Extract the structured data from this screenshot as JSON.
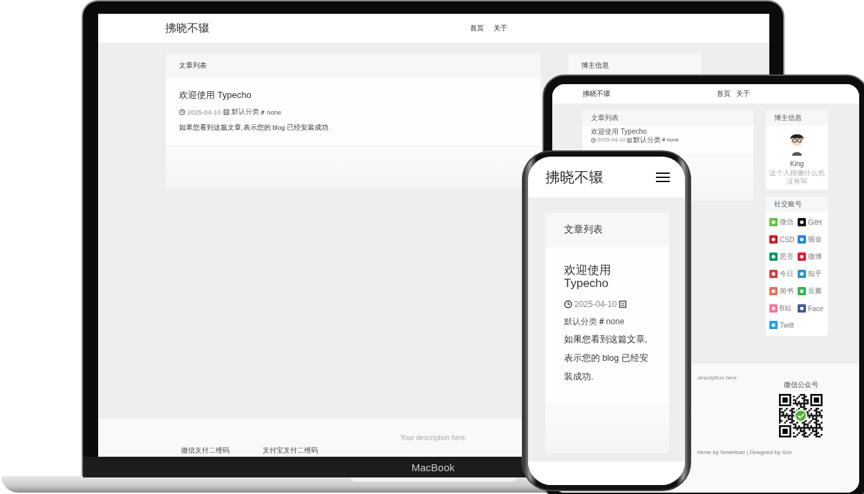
{
  "laptop": {
    "site": {
      "logo": "拂晓不辍",
      "nav": [
        {
          "label": "首页"
        },
        {
          "label": "关于"
        }
      ],
      "posts_card": {
        "title": "文章列表",
        "post": {
          "title": "欢迎使用 Typecho",
          "date": "2025-04-10",
          "category": "默认分类",
          "tag_symbol": "#",
          "tag": "none",
          "excerpt": "如果您看到这篇文章,表示您的 blog 已经安装成功."
        }
      },
      "profile_card": {
        "title": "博主信息"
      },
      "footer": {
        "description": "Your description here.",
        "qr_labels": [
          "微信支付二维码",
          "支付宝支付二维码"
        ]
      }
    },
    "brand": "MacBook"
  },
  "tablet": {
    "site": {
      "logo": "拂晓不辍",
      "nav": [
        {
          "label": "首页"
        },
        {
          "label": "关于"
        }
      ],
      "posts_card": {
        "title": "文章列表",
        "post": {
          "title": "欢迎使用 Typecho",
          "date": "2025-04-10",
          "category": "默认分类",
          "tag_symbol": "#",
          "tag": "none"
        }
      },
      "profile_card": {
        "title": "博主信息",
        "name": "King",
        "bio": "这个人很懒什么也没有写"
      },
      "social_card": {
        "title": "社交账号",
        "items": [
          {
            "label": "微信",
            "color": "#5ac73d"
          },
          {
            "label": "GitH",
            "color": "#111111"
          },
          {
            "label": "CSD",
            "color": "#d7131f"
          },
          {
            "label": "掘金",
            "color": "#1e80ff"
          },
          {
            "label": "思否",
            "color": "#009a61"
          },
          {
            "label": "微博",
            "color": "#e6162d"
          },
          {
            "label": "今日",
            "color": "#d43d3d"
          },
          {
            "label": "知乎",
            "color": "#2f8fd8"
          },
          {
            "label": "简书",
            "color": "#ea6f5a"
          },
          {
            "label": "豆瓣",
            "color": "#2db84d"
          },
          {
            "label": "B站",
            "color": "#fb7299"
          },
          {
            "label": "Face",
            "color": "#3b5998"
          },
          {
            "label": "Twitt",
            "color": "#1da1f2"
          }
        ]
      },
      "footer": {
        "description": "description here.",
        "qr_title": "微信公众号",
        "credits": "heme by Smartisan |  Designed by Son"
      }
    }
  },
  "phone": {
    "site": {
      "logo": "拂晓不辍",
      "posts_card": {
        "title": "文章列表",
        "post": {
          "title": "欢迎使用 Typecho",
          "date": "2025-04-10",
          "category": "默认分类",
          "tag_symbol": "#",
          "tag": "none",
          "excerpt": "如果您看到这篇文章,表示您的 blog 已经安装成功."
        }
      }
    }
  }
}
